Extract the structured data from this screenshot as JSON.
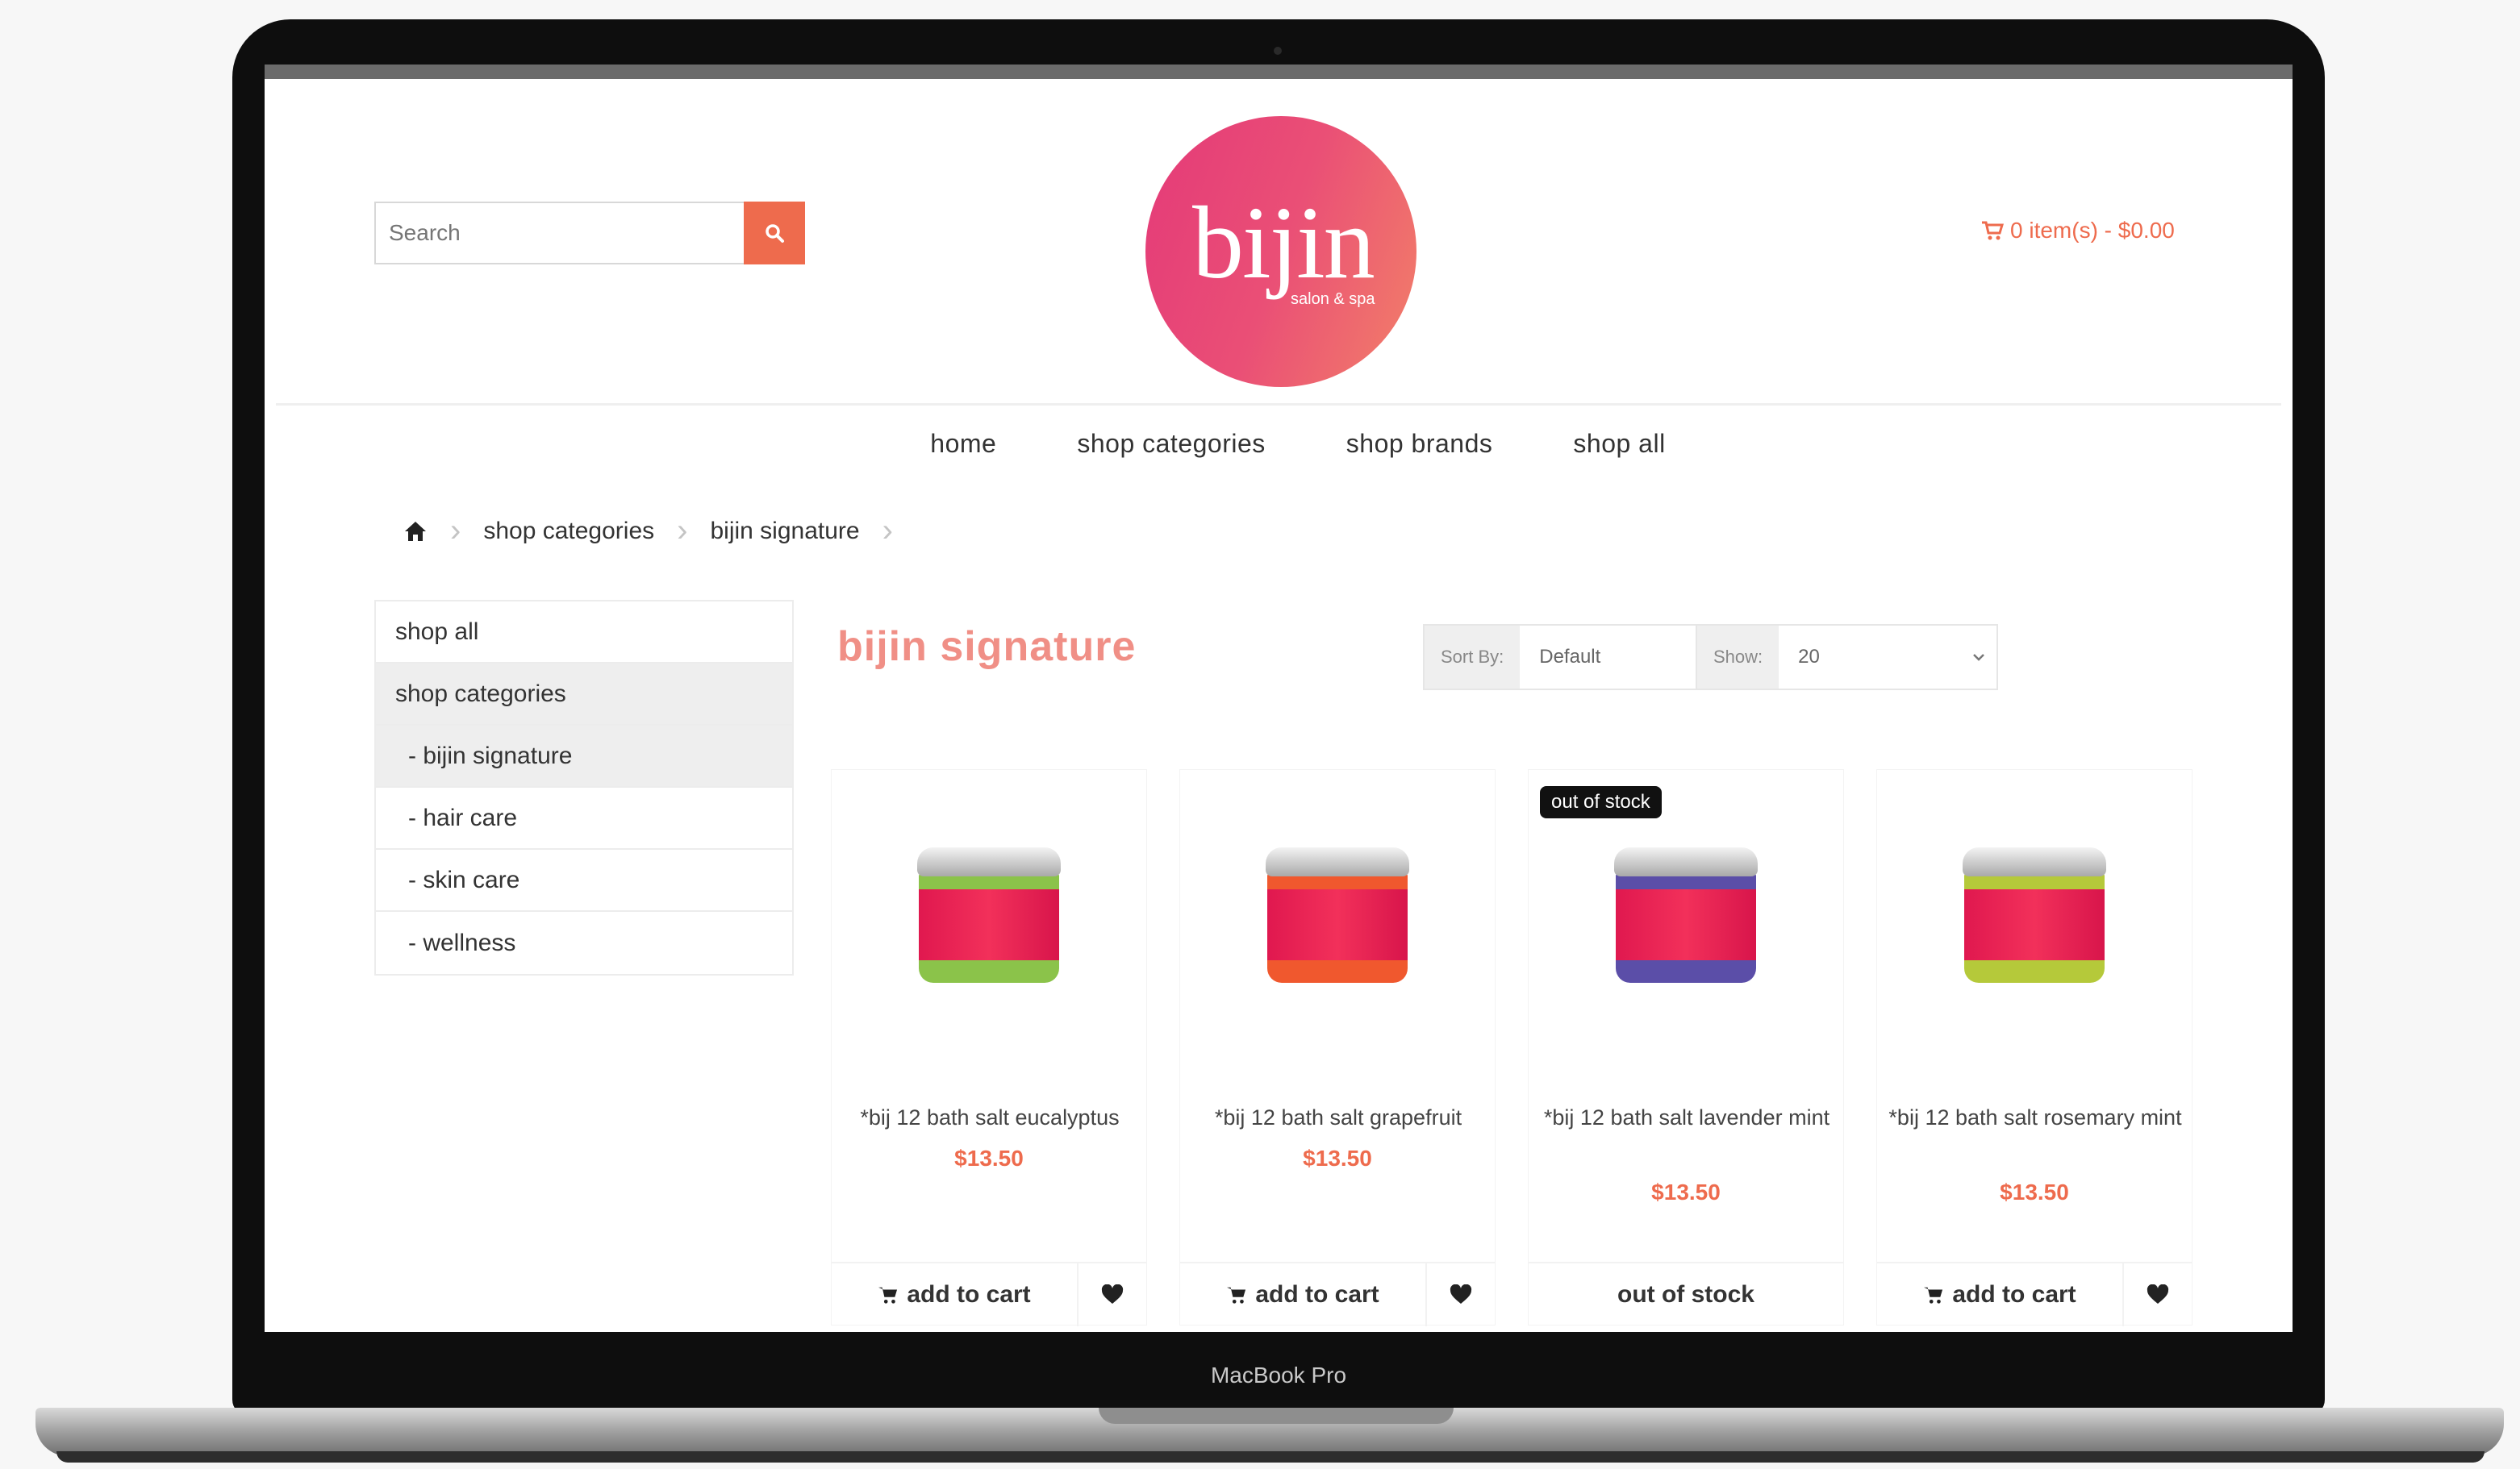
{
  "laptop": {
    "model_label": "MacBook Pro"
  },
  "header": {
    "search_placeholder": "Search",
    "logo_text": "bijin",
    "logo_tagline": "salon & spa",
    "cart_text": "0 item(s) - $0.00"
  },
  "nav": [
    "home",
    "shop categories",
    "shop brands",
    "shop all"
  ],
  "breadcrumb": [
    "shop categories",
    "bijin signature"
  ],
  "sidebar": [
    "shop all",
    "shop categories",
    "- bijin signature",
    "- hair care",
    "- skin care",
    "- wellness"
  ],
  "content": {
    "title": "bijin signature",
    "sort_label": "Sort By:",
    "sort_value": "Default",
    "show_label": "Show:",
    "show_value": "20"
  },
  "products": [
    {
      "name": "*bij 12 bath salt eucalyptus",
      "price": "$13.50",
      "action": "add to cart",
      "badge": "",
      "salt_color": "#8bc34a"
    },
    {
      "name": "*bij 12 bath salt grapefruit",
      "price": "$13.50",
      "action": "add to cart",
      "badge": "",
      "salt_color": "#f0582e"
    },
    {
      "name": "*bij 12 bath salt lavender mint",
      "price": "$13.50",
      "action": "out of stock",
      "badge": "out of stock",
      "salt_color": "#5b4ea8"
    },
    {
      "name": "*bij 12 bath salt rosemary mint",
      "price": "$13.50",
      "action": "add to cart",
      "badge": "",
      "salt_color": "#b5c93a"
    }
  ],
  "colors": {
    "accent": "#ee6b4d",
    "title": "#f08f86",
    "logo_start": "#e43a78",
    "logo_end": "#f28068"
  }
}
